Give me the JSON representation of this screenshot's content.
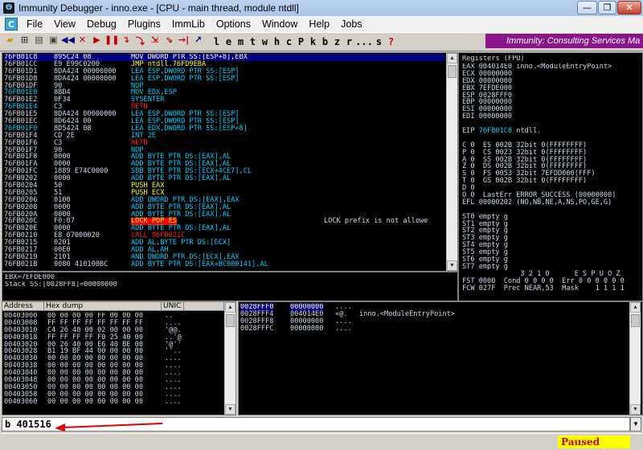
{
  "window": {
    "title": "Immunity Debugger - inno.exe - [CPU - main thread, module ntdll]",
    "min": "—",
    "max": "❐",
    "close": "✕"
  },
  "menu": [
    "File",
    "View",
    "Debug",
    "Plugins",
    "ImmLib",
    "Options",
    "Window",
    "Help",
    "Jobs"
  ],
  "toolbar": {
    "letters": [
      "l",
      "e",
      "m",
      "t",
      "w",
      "h",
      "c",
      "P",
      "k",
      "b",
      "z",
      "r",
      "...",
      "s",
      "?"
    ],
    "banner": "Immunity: Consulting Services Ma"
  },
  "disasm": [
    {
      "a": "76FB01C8",
      "h": "895C24 08",
      "m": "MOV DWORD PTR SS:[ESP+8],EBX",
      "k": "sel"
    },
    {
      "a": "76FB01CC",
      "h": "E9 E99C0200",
      "m": "JMP ntdll.76FD9EBA",
      "k": "y"
    },
    {
      "a": "76FB01D1",
      "h": "8DA424 00000000",
      "m": "LEA ESP,DWORD PTR SS:[ESP]",
      "k": "c"
    },
    {
      "a": "76FB01D8",
      "h": "8DA424 00000000",
      "m": "LEA ESP,DWORD PTR SS:[ESP]",
      "k": "c"
    },
    {
      "a": "76FB01DF",
      "h": "90",
      "m": "NOP",
      "k": "c"
    },
    {
      "a": "76FB01E0",
      "h": "8BD4",
      "m": "MOV EDX,ESP",
      "k": "c",
      "ac": "c"
    },
    {
      "a": "76FB01E2",
      "h": "0F34",
      "m": "SYSENTER",
      "k": "c"
    },
    {
      "a": "76FB01E4",
      "h": "C3",
      "m": "RETN",
      "k": "r",
      "ac": "c"
    },
    {
      "a": "76FB01E5",
      "h": "8DA424 00000000",
      "m": "LEA ESP,DWORD PTR SS:[ESP]",
      "k": "c"
    },
    {
      "a": "76FB01EC",
      "h": "8D6424 00",
      "m": "LEA ESP,DWORD PTR SS:[ESP]",
      "k": "c"
    },
    {
      "a": "76FB01F0",
      "h": "8D5424 08",
      "m": "LEA EDX,DWORD PTR SS:[ESP+8]",
      "k": "c",
      "ac": "c"
    },
    {
      "a": "76FB01F4",
      "h": "CD 2E",
      "m": "INT 2E",
      "k": "c"
    },
    {
      "a": "76FB01F6",
      "h": "C3",
      "m": "RETN",
      "k": "r"
    },
    {
      "a": "76FB01F7",
      "h": "90",
      "m": "NOP",
      "k": "c"
    },
    {
      "a": "76FB01F8",
      "h": "0000",
      "m": "ADD BYTE PTR DS:[EAX],AL",
      "k": "c"
    },
    {
      "a": "76FB01FA",
      "h": "0000",
      "m": "ADD BYTE PTR DS:[EAX],AL",
      "k": "c"
    },
    {
      "a": "76FB01FC",
      "h": "1889 E74C0000",
      "m": "SBB BYTE PTR DS:[ECX+4CE7],CL",
      "k": "c"
    },
    {
      "a": "76FB0202",
      "h": "0000",
      "m": "ADD BYTE PTR DS:[EAX],AL",
      "k": "c"
    },
    {
      "a": "76FB0204",
      "h": "50",
      "m": "PUSH EAX",
      "k": "y"
    },
    {
      "a": "76FB0205",
      "h": "51",
      "m": "PUSH ECX",
      "k": "y"
    },
    {
      "a": "76FB0206",
      "h": "0100",
      "m": "ADD DWORD PTR DS:[EAX],EAX",
      "k": "c"
    },
    {
      "a": "76FB0208",
      "h": "0000",
      "m": "ADD BYTE PTR DS:[EAX],AL",
      "k": "c"
    },
    {
      "a": "76FB020A",
      "h": "0000",
      "m": "ADD BYTE PTR DS:[EAX],AL",
      "k": "c"
    },
    {
      "a": "76FB020C",
      "h": "F0:07",
      "m": "LOCK POP ES",
      "k": "hl",
      "cm": "LOCK prefix is not allowe"
    },
    {
      "a": "76FB020E",
      "h": "0000",
      "m": "ADD BYTE PTR DS:[EAX],AL",
      "k": "c"
    },
    {
      "a": "76FB0210",
      "h": "E8 07000020",
      "m": "CALL 96FB021C",
      "k": "r"
    },
    {
      "a": "76FB0215",
      "h": "0201",
      "m": "ADD AL,BYTE PTR DS:[ECX]",
      "k": "c"
    },
    {
      "a": "76FB0217",
      "h": "00E0",
      "m": "ADD AL,AH",
      "k": "c"
    },
    {
      "a": "76FB0219",
      "h": "2101",
      "m": "AND DWORD PTR DS:[ECX],EAX",
      "k": "c"
    },
    {
      "a": "76FB021B",
      "h": "0080 410100BC",
      "m": "ADD BYTE PTR DS:[EAX+BC000141],AL",
      "k": "c"
    }
  ],
  "info": [
    "EBX=7EFDE000",
    "Stack SS:[0028FF8]=00000000"
  ],
  "registers": {
    "title": "Registers (FPU)",
    "lines": [
      {
        "t": "EAX 004014E0 inno.<ModuleEntryPoint>"
      },
      {
        "t": "ECX 00000000"
      },
      {
        "t": "EDX 00000000"
      },
      {
        "t": "EBX 7EFDE000"
      },
      {
        "t": "ESP 0028FFF0"
      },
      {
        "t": "EBP 00000000"
      },
      {
        "t": "ESI 00000000"
      },
      {
        "t": "EDI 00000000"
      },
      {
        "t": ""
      },
      {
        "t": "EIP 76FB01C8 ntdll.76FB01C8",
        "hl": "76FB01C8"
      },
      {
        "t": ""
      },
      {
        "t": "C 0  ES 002B 32bit 0(FFFFFFFF)"
      },
      {
        "t": "P 0  CS 0023 32bit 0(FFFFFFFF)"
      },
      {
        "t": "A 0  SS 002B 32bit 0(FFFFFFFF)"
      },
      {
        "t": "Z 0  DS 002B 32bit 0(FFFFFFFF)"
      },
      {
        "t": "S 0  FS 0053 32bit 7EFDD000(FFF)"
      },
      {
        "t": "T 0  GS 002B 32bit 0(FFFFFFFF)"
      },
      {
        "t": "D 0"
      },
      {
        "t": "O 0  LastErr ERROR_SUCCESS (00000000)"
      },
      {
        "t": "EFL 00000202 (NO,NB,NE,A,NS,PO,GE,G)"
      },
      {
        "t": ""
      },
      {
        "t": "ST0 empty g"
      },
      {
        "t": "ST1 empty g"
      },
      {
        "t": "ST2 empty g"
      },
      {
        "t": "ST3 empty g"
      },
      {
        "t": "ST4 empty g"
      },
      {
        "t": "ST5 empty g"
      },
      {
        "t": "ST6 empty g"
      },
      {
        "t": "ST7 empty g"
      },
      {
        "t": "              3 2 1 0      E S P U O Z"
      },
      {
        "t": "FST 0000  Cond 0 0 0 0  Err 0 0 0 0 0 0"
      },
      {
        "t": "FCW 027F  Prec NEAR,53  Mask    1 1 1 1"
      }
    ]
  },
  "dump": {
    "headers": [
      "Address",
      "Hex dump",
      "UNIC"
    ],
    "rows": [
      [
        "00403000",
        "00 00 00 00 FF 00 00 00",
        ".."
      ],
      [
        "00403008",
        "FF FF FF FF FF FF FF FF",
        "...."
      ],
      [
        "00403010",
        "C4 26 40 00 02 00 00 00",
        "'@@."
      ],
      [
        "00403018",
        "FF FF FF FF F0 25 40 00",
        "..'@"
      ],
      [
        "00403020",
        "00 26 40 00 E6 40 BE 00",
        "'@''"
      ],
      [
        "00403028",
        "B1 19 BF 44 00 00 00 00",
        "''.."
      ],
      [
        "00403030",
        "00 00 00 00 00 00 00 00",
        "...."
      ],
      [
        "00403038",
        "00 00 00 00 00 00 00 00",
        "...."
      ],
      [
        "00403040",
        "00 00 00 00 00 00 00 00",
        "...."
      ],
      [
        "00403048",
        "00 00 00 00 00 00 00 00",
        "...."
      ],
      [
        "00403050",
        "00 00 00 00 00 00 00 00",
        "...."
      ],
      [
        "00403058",
        "00 00 00 00 00 00 00 00",
        "...."
      ],
      [
        "00403060",
        "00 00 00 00 00 00 00 00",
        "...."
      ]
    ]
  },
  "stack": [
    {
      "a": "0028FFF0",
      "v": "00000000",
      "c": "....",
      "sel": true
    },
    {
      "a": "0028FFF4",
      "v": "004014E0",
      "c": "«@.",
      "x": "inno.<ModuleEntryPoint>"
    },
    {
      "a": "0028FFF8",
      "v": "00000000",
      "c": "...."
    },
    {
      "a": "0028FFFC",
      "v": "00000000",
      "c": "...."
    }
  ],
  "command": {
    "value": "b 401516"
  },
  "status": {
    "state": "Paused"
  }
}
